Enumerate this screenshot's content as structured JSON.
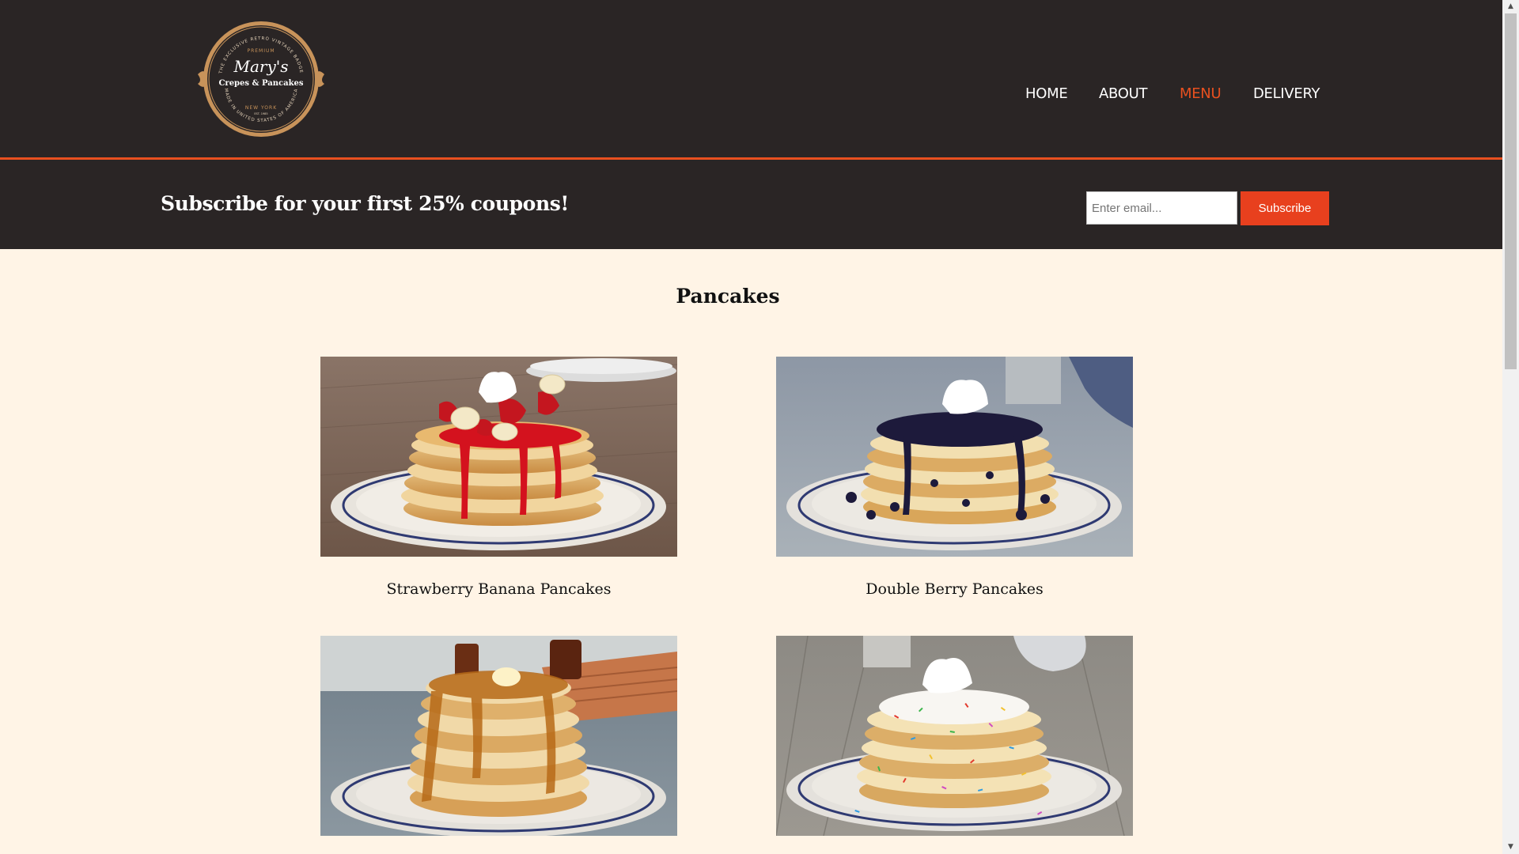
{
  "header": {
    "logo": {
      "top_arc": "THE EXCLUSIVE RETRO VINTAGE BADGE",
      "premium": "PREMIUM",
      "name": "Mary's",
      "subtitle": "Crepes & Pancakes",
      "city": "NEW YORK",
      "est": "EST. 1985",
      "bottom_arc": "MADE IN UNITED STATES OF AMERICA"
    },
    "nav": {
      "items": [
        {
          "label": "HOME",
          "active": false
        },
        {
          "label": "ABOUT",
          "active": false
        },
        {
          "label": "MENU",
          "active": true
        },
        {
          "label": "DELIVERY",
          "active": false
        }
      ]
    }
  },
  "subscribe": {
    "text": "Subscribe for your first 25% coupons!",
    "email_placeholder": "Enter email...",
    "email_value": "",
    "button_label": "Subscribe"
  },
  "main": {
    "section_title": "Pancakes",
    "items": [
      {
        "title": "Strawberry Banana Pancakes",
        "image": "strawberry-banana-pancakes-photo"
      },
      {
        "title": "Double Berry Pancakes",
        "image": "double-berry-pancakes-photo"
      },
      {
        "title": "",
        "image": "buttermilk-pancakes-syrup-photo"
      },
      {
        "title": "",
        "image": "funfetti-sprinkle-pancakes-photo"
      }
    ]
  },
  "colors": {
    "header_bg": "#2a2525",
    "accent": "#e8501f",
    "page_bg": "#fff4e6",
    "logo_gold": "#c8935a"
  },
  "scrollbar": {
    "up_icon": "scroll-up-arrow-icon",
    "down_icon": "scroll-down-arrow-icon"
  }
}
